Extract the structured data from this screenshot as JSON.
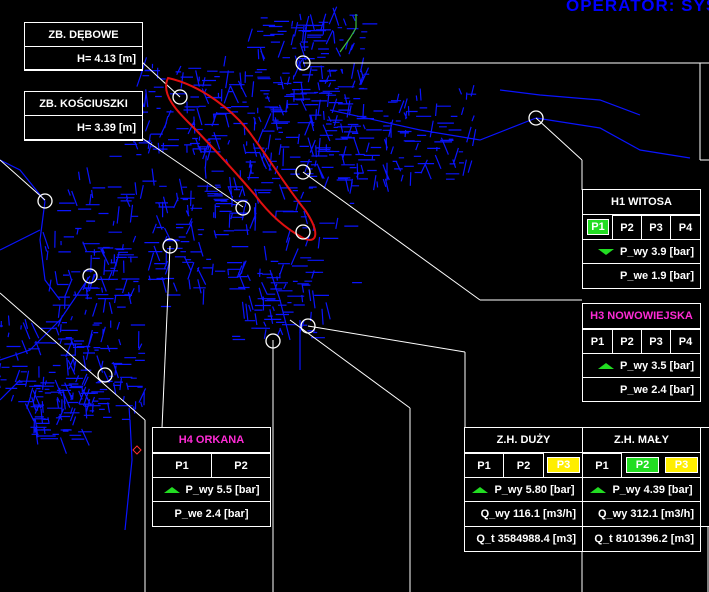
{
  "operator": "OPERATOR: SYS",
  "reservoirs": [
    {
      "name": "ZB. DĘBOWE",
      "level": "H= 4.13 [m]"
    },
    {
      "name": "ZB. KOŚCIUSZKI",
      "level": "H= 3.39 [m]"
    }
  ],
  "h1": {
    "name": "H1 WITOSA",
    "pumps": [
      "P1",
      "P2",
      "P3",
      "P4"
    ],
    "p_out": "P_wy  3.9 [bar]",
    "p_in": "P_we  1.9 [bar]"
  },
  "h3": {
    "name": "H3 NOWOWIEJSKA",
    "pumps": [
      "P1",
      "P2",
      "P3",
      "P4"
    ],
    "p_out": "P_wy  3.5 [bar]",
    "p_in": "P_we  2.4 [bar]"
  },
  "h4": {
    "name": "H4 ORKANA",
    "pumps": [
      "P1",
      "P2"
    ],
    "p_out": "P_wy  5.5 [bar]",
    "p_in": "P_we  2.4 [bar]"
  },
  "zh_duzy": {
    "name": "Z.H. DUŻY",
    "pumps": [
      "P1",
      "P2",
      "P3"
    ],
    "p_out": "P_wy  5.80 [bar]",
    "q_out": "Q_wy  116.1 [m3/h]",
    "q_total": "Q_t  3584988.4 [m3]"
  },
  "zh_maly": {
    "name": "Z.H. MAŁY",
    "pumps": [
      "P1",
      "P2",
      "P3"
    ],
    "p_out": "P_wy  4.39 [bar]",
    "q_out": "Q_wy  312.1 [m3/h]",
    "q_total": "Q_t  8101396.2 [m3]"
  },
  "colors": {
    "pipe": "#0a14ff",
    "pump_running": "#22dd22",
    "pump_alarm": "#ffee00",
    "station_label": "#ff2bd6",
    "highlight": "#e01010"
  }
}
